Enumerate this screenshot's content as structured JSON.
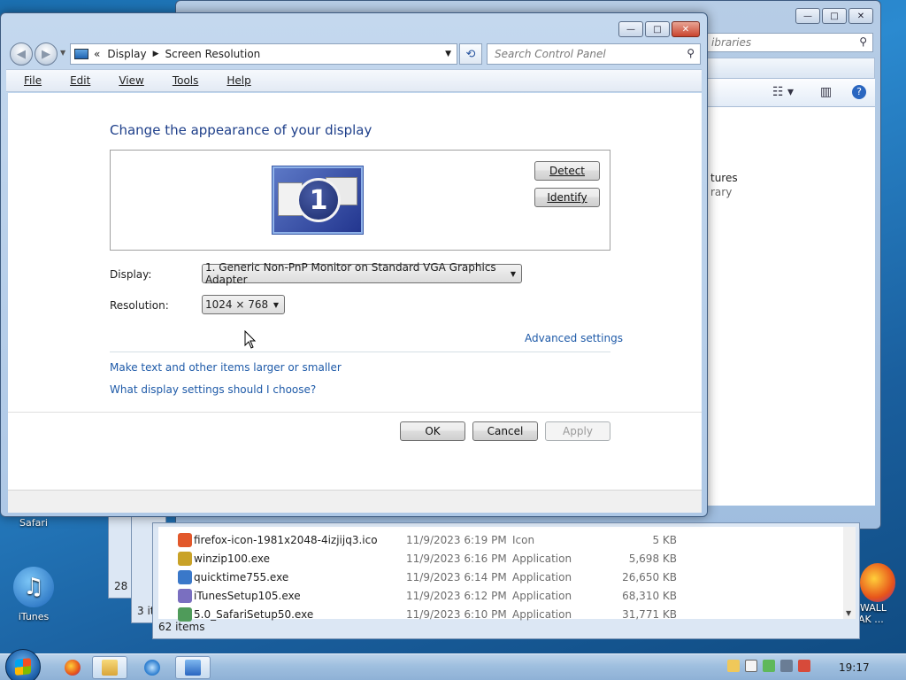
{
  "desktop": {
    "safari_label": "Safari",
    "itunes_label": "iTunes",
    "firewall_label_1": "WALL",
    "firewall_label_2": "AK ..."
  },
  "back_explorer": {
    "search_text": "ibraries",
    "library_title": "tures",
    "library_sub": "rary"
  },
  "stack_windows": {
    "count_a": "28",
    "count_b": "3 it"
  },
  "file_list": {
    "rows": [
      {
        "name": "firefox-icon-1981x2048-4izjijq3.ico",
        "date": "11/9/2023 6:19 PM",
        "type": "Icon",
        "size": "5 KB",
        "color": "#e2582b"
      },
      {
        "name": "winzip100.exe",
        "date": "11/9/2023 6:16 PM",
        "type": "Application",
        "size": "5,698 KB",
        "color": "#c9a227"
      },
      {
        "name": "quicktime755.exe",
        "date": "11/9/2023 6:14 PM",
        "type": "Application",
        "size": "26,650 KB",
        "color": "#3a78c9"
      },
      {
        "name": "iTunesSetup105.exe",
        "date": "11/9/2023 6:12 PM",
        "type": "Application",
        "size": "68,310 KB",
        "color": "#7a6fc0"
      },
      {
        "name": "5.0_SafariSetup50.exe",
        "date": "11/9/2023 6:10 PM",
        "type": "Application",
        "size": "31,771 KB",
        "color": "#4f9b5a"
      }
    ],
    "status": "62 items"
  },
  "display_window": {
    "breadcrumb": {
      "root_chevron": "«",
      "item1": "Display",
      "item2": "Screen Resolution"
    },
    "search_placeholder": "Search Control Panel",
    "menu": {
      "file": "File",
      "edit": "Edit",
      "view": "View",
      "tools": "Tools",
      "help": "Help"
    },
    "heading": "Change the appearance of your display",
    "monitor_number": "1",
    "detect_label": "Detect",
    "identify_label": "Identify",
    "display_label": "Display:",
    "display_value": "1. Generic Non-PnP Monitor on Standard VGA Graphics Adapter",
    "resolution_label": "Resolution:",
    "resolution_value": "1024 × 768",
    "advanced_link": "Advanced settings",
    "link_text_size": "Make text and other items larger or smaller",
    "link_help": "What display settings should I choose?",
    "ok_label": "OK",
    "cancel_label": "Cancel",
    "apply_label": "Apply"
  },
  "taskbar": {
    "clock": "19:17"
  },
  "colors": {
    "link": "#1e5aa8",
    "heading": "#1e3f8a"
  }
}
